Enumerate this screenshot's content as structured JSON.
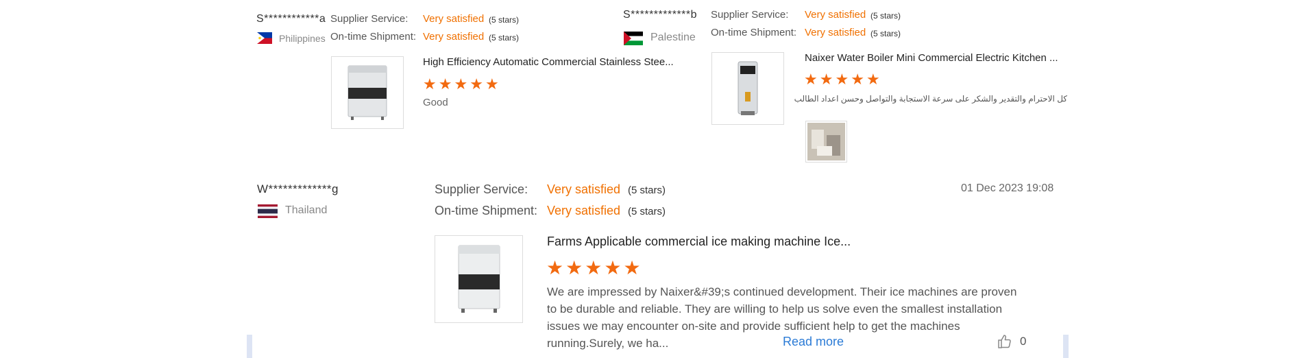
{
  "reviews": [
    {
      "username": "S************a",
      "country": "Philippines",
      "supplier_label": "Supplier Service:",
      "supplier_value": "Very satisfied",
      "supplier_stars": "(5 stars)",
      "shipment_label": "On-time Shipment:",
      "shipment_value": "Very satisfied",
      "shipment_stars": "(5 stars)",
      "product_title": "High Efficiency Automatic Commercial Stainless Stee...",
      "rating": 5,
      "comment": "Good"
    },
    {
      "username": "S*************b",
      "country": "Palestine",
      "supplier_label": "Supplier Service:",
      "supplier_value": "Very satisfied",
      "supplier_stars": "(5 stars)",
      "shipment_label": "On-time Shipment:",
      "shipment_value": "Very satisfied",
      "shipment_stars": "(5 stars)",
      "product_title": "Naixer Water Boiler Mini Commercial Electric Kitchen ...",
      "rating": 5,
      "comment": "كل الاحترام والتقدير والشكر على سرعة الاستجابة والتواصل وحسن اعداد الطالب"
    },
    {
      "username": "W*************g",
      "country": "Thailand",
      "supplier_label": "Supplier Service:",
      "supplier_value": "Very satisfied",
      "supplier_stars": "(5 stars)",
      "shipment_label": "On-time Shipment:",
      "shipment_value": "Very satisfied",
      "shipment_stars": "(5 stars)",
      "date": "01 Dec 2023 19:08",
      "product_title": "Farms Applicable commercial ice making machine Ice...",
      "rating": 5,
      "comment": "We are impressed by Naixer&#39;s continued development. Their ice machines are proven to be durable and reliable. They are willing to help us solve even the smallest installation issues we may encounter on-site and provide sufficient help to get the machines running.Surely, we ha...",
      "read_more": "Read more",
      "likes": "0"
    }
  ],
  "colors": {
    "satisfied": "#f07000",
    "star": "#f26a10",
    "link": "#2b7bd6"
  }
}
